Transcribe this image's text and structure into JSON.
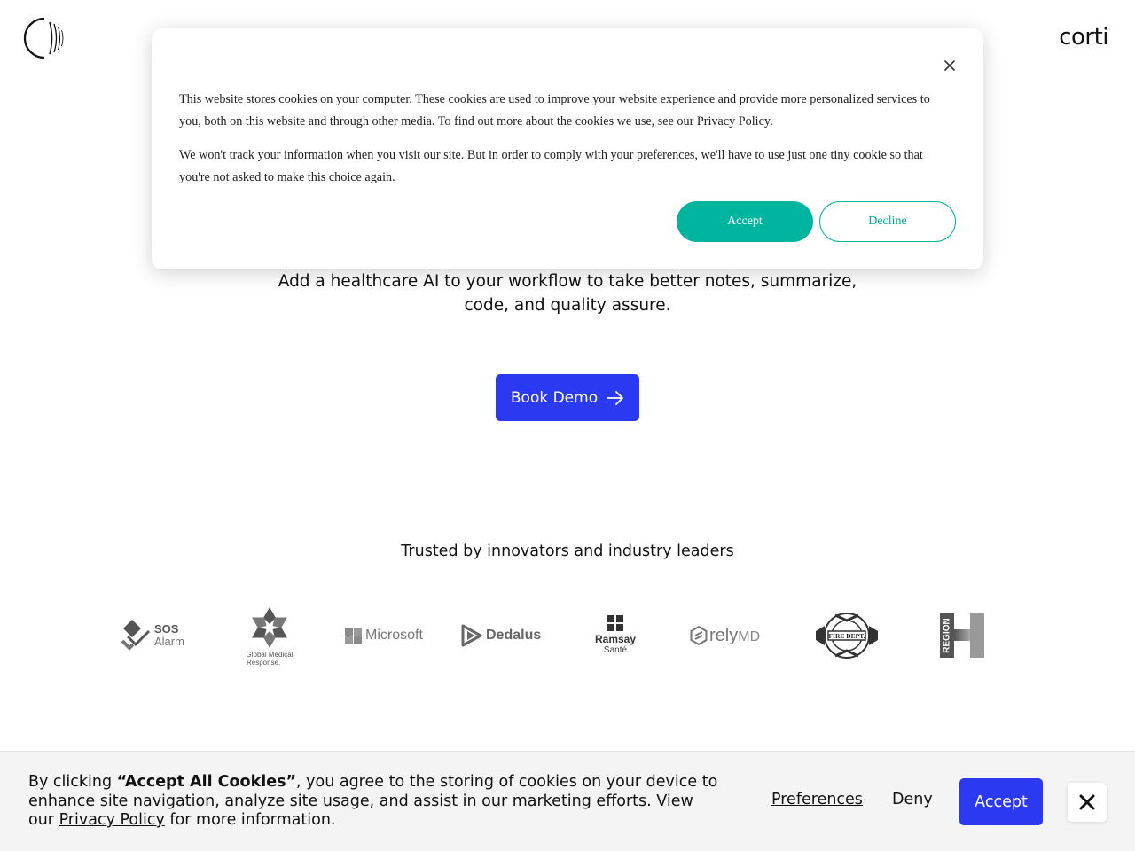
{
  "header": {
    "logo_icon": "corti-mark-icon",
    "wordmark": "corti"
  },
  "hero": {
    "subtitle_line1": "Add a healthcare AI to your workflow to take better notes, summarize,",
    "subtitle_line2": "code, and quality assure.",
    "cta_label": "Book Demo",
    "cta_icon": "arrow-right-icon",
    "cta_color": "#2b3af0"
  },
  "trusted": {
    "heading": "Trusted by innovators and industry leaders",
    "logos": [
      {
        "name": "SOS Alarm",
        "line1": "SOS",
        "line2": "Alarm"
      },
      {
        "name": "Global Medical Response",
        "line1": "Global Medical",
        "line2": "Response."
      },
      {
        "name": "Microsoft",
        "text": "Microsoft"
      },
      {
        "name": "Dedalus",
        "text": "Dedalus"
      },
      {
        "name": "Ramsay Santé",
        "line1": "Ramsay",
        "line2": "Santé"
      },
      {
        "name": "relyMD",
        "text_a": "rely",
        "text_b": "MD"
      },
      {
        "name": "Fire Dept",
        "text": "FIRE DEPT."
      },
      {
        "name": "Region H",
        "text": "REGION"
      }
    ]
  },
  "cookie_modal": {
    "paragraph1": "This website stores cookies on your computer. These cookies are used to improve your website experience and provide more personalized services to you, both on this website and through other media. To find out more about the cookies we use, see our Privacy Policy.",
    "paragraph2": "We won't track your information when you visit our site. But in order to comply with your preferences, we'll have to use just one tiny cookie so that you're not asked to make this choice again.",
    "accept_label": "Accept",
    "decline_label": "Decline",
    "accent_color": "#00b5a0",
    "close_icon": "close-icon"
  },
  "cookie_bar": {
    "text_before": "By clicking ",
    "text_bold": "“Accept All Cookies”",
    "text_after": ", you agree to the storing of cookies on your device to enhance site navigation, analyze site usage, and assist in our marketing efforts. View our ",
    "privacy_link": "Privacy Policy",
    "text_end": " for more information.",
    "preferences_label": "Preferences",
    "deny_label": "Deny",
    "accept_label": "Accept",
    "close_icon": "close-icon"
  }
}
